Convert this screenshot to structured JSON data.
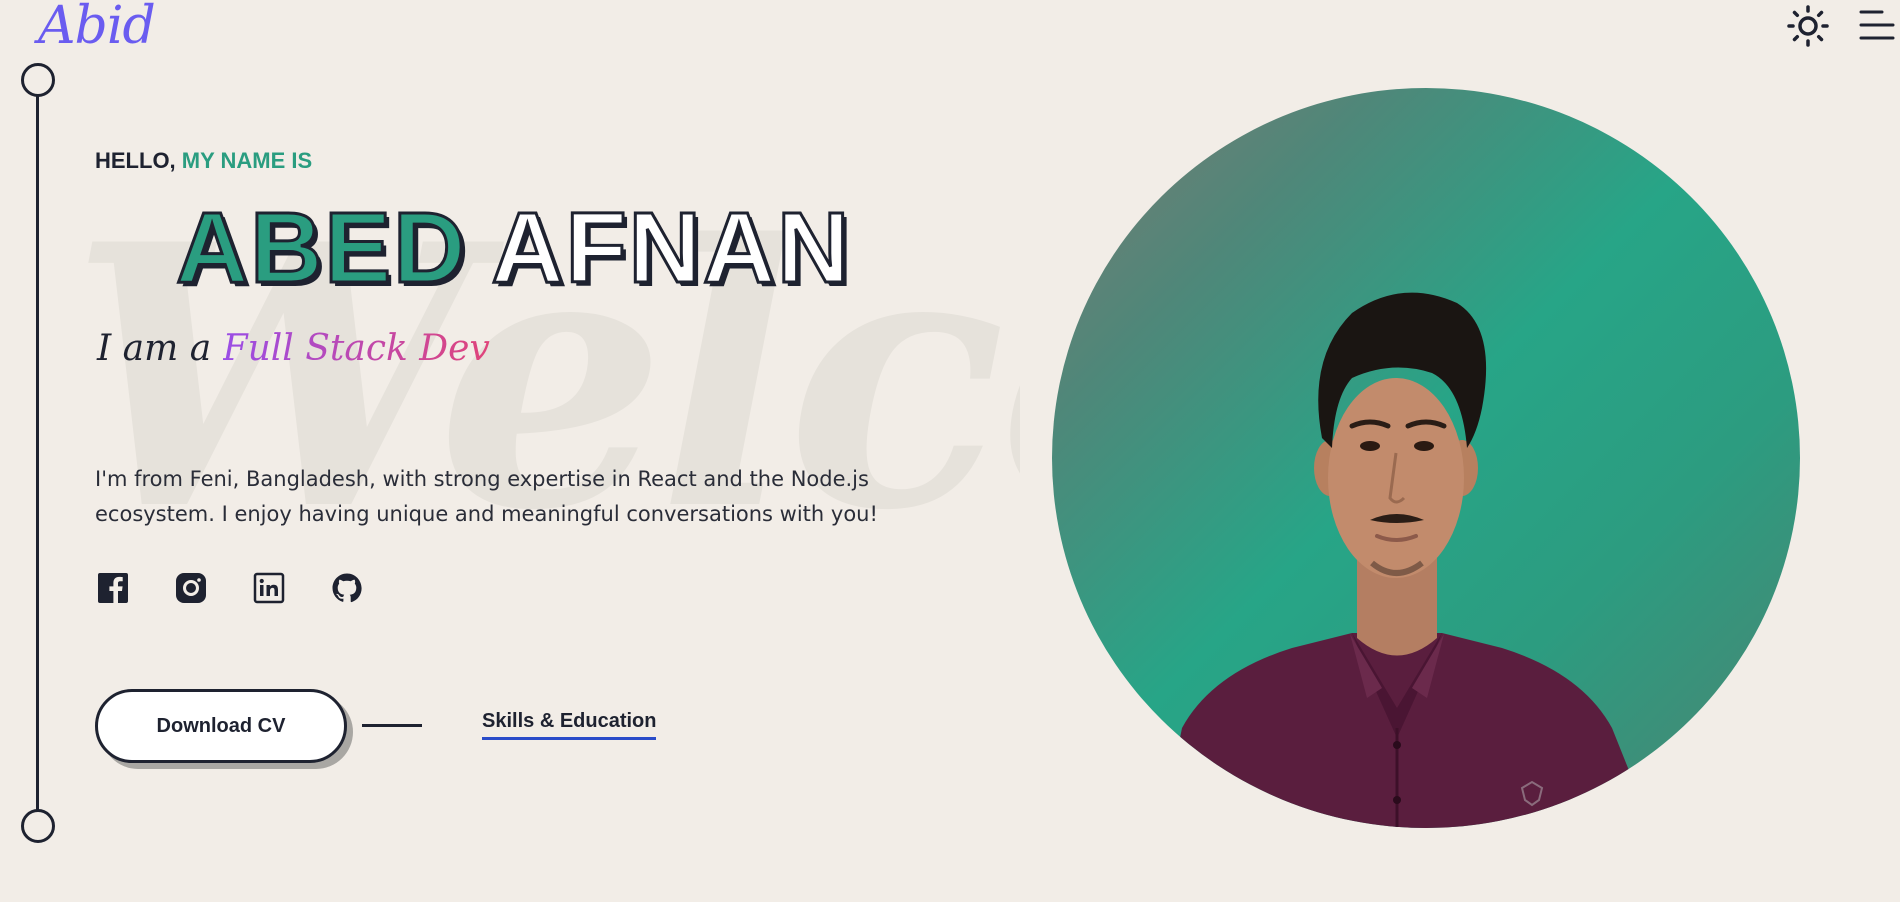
{
  "header": {
    "logo_text": "Abid",
    "theme_icon": "sun-icon",
    "menu_icon": "hamburger-menu-icon"
  },
  "background": {
    "watermark_text": "Welcome"
  },
  "hero": {
    "greeting_prefix": "HELLO, ",
    "greeting_accent": "MY NAME IS",
    "first_name": "ABED",
    "last_name": "AFNAN",
    "role_prefix": "I am a ",
    "role_highlight": "Full Stack Dev",
    "bio": "I'm from Feni, Bangladesh, with strong expertise in React and the Node.js ecosystem. I enjoy having unique and meaningful conversations with you!",
    "socials": [
      {
        "name": "facebook",
        "icon": "facebook-icon"
      },
      {
        "name": "instagram",
        "icon": "instagram-icon"
      },
      {
        "name": "linkedin",
        "icon": "linkedin-icon"
      },
      {
        "name": "github",
        "icon": "github-icon"
      }
    ],
    "download_cv_label": "Download CV",
    "skills_link_label": "Skills & Education"
  },
  "colors": {
    "background": "#f2ede7",
    "accent_green": "#2a9d80",
    "logo_purple": "#6a5cf0",
    "text_dark": "#1e2230",
    "link_underline": "#2a4cc9",
    "role_gradient_start": "#9a4de6",
    "role_gradient_end": "#e0447a"
  }
}
